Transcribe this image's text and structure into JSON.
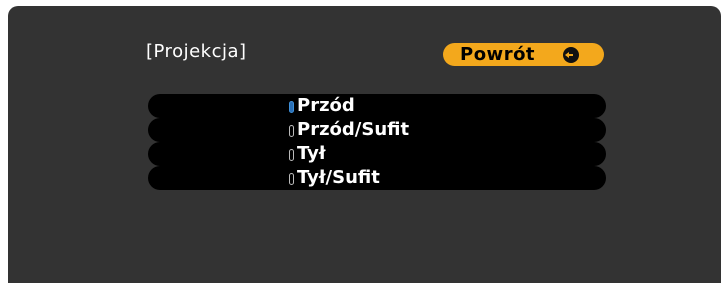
{
  "menu": {
    "title": "[Projekcja]",
    "back_label": "Powrót"
  },
  "options": [
    {
      "label": "Przód",
      "selected": true
    },
    {
      "label": "Przód/Sufit",
      "selected": false
    },
    {
      "label": "Tył",
      "selected": false
    },
    {
      "label": "Tył/Sufit",
      "selected": false
    }
  ],
  "colors": {
    "panel": "#333333",
    "button": "#f3a81c",
    "radio_selected": "#2a6fb5"
  },
  "icons": {
    "back_button_icon": "enter-icon"
  }
}
